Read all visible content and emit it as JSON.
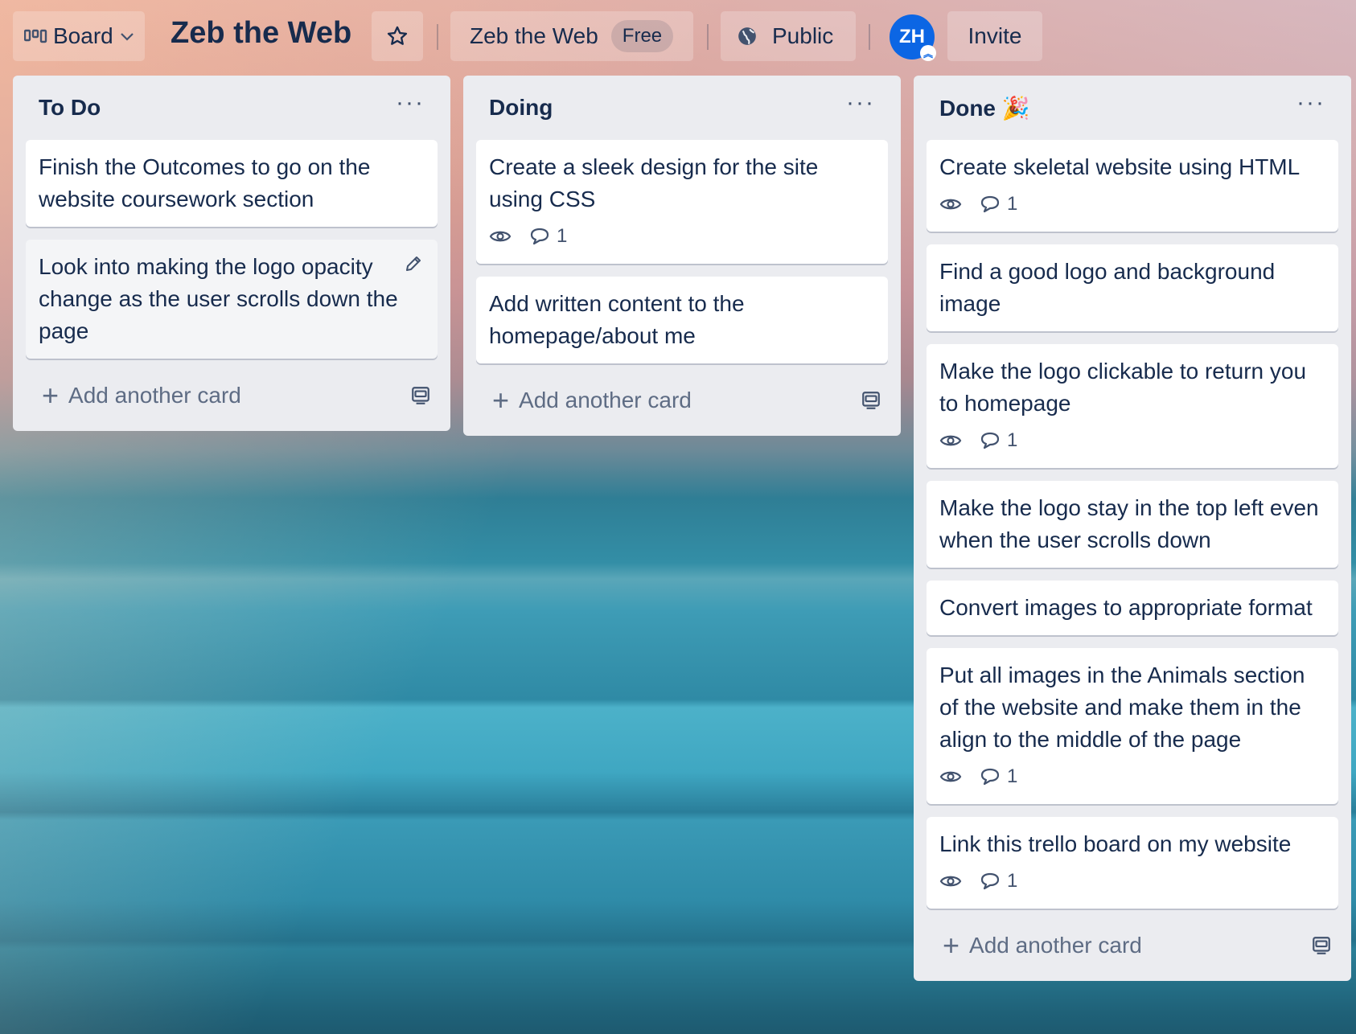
{
  "topbar": {
    "view_label": "Board",
    "board_title": "Zeb the Web",
    "workspace_name": "Zeb the Web",
    "workspace_plan": "Free",
    "visibility_label": "Public",
    "avatar_initials": "ZH",
    "invite_label": "Invite"
  },
  "lists": [
    {
      "title": "To Do",
      "title_emoji": "",
      "add_card_label": "Add another card",
      "cards": [
        {
          "text": "Finish the Outcomes to go on the website coursework section"
        },
        {
          "text": "Look into making the logo opacity change as the user scrolls down the page"
        }
      ]
    },
    {
      "title": "Doing",
      "title_emoji": "",
      "add_card_label": "Add another card",
      "cards": [
        {
          "text": "Create a sleek design for the site using CSS",
          "comments": "1"
        },
        {
          "text": "Add written content to the homepage/about me"
        }
      ]
    },
    {
      "title": "Done",
      "title_emoji": "🎉",
      "add_card_label": "Add another card",
      "cards": [
        {
          "text": "Create skeletal website using HTML",
          "comments": "1"
        },
        {
          "text": "Find a good logo and background image"
        },
        {
          "text": "Make the logo clickable to return you to homepage",
          "comments": "1"
        },
        {
          "text": "Make the logo stay in the top left even when the user scrolls down"
        },
        {
          "text": "Convert images to appropriate format"
        },
        {
          "text": "Put all images in the Animals section of the website and make them in the align to the middle of the page",
          "comments": "1"
        },
        {
          "text": "Link this trello board on my website",
          "comments": "1"
        }
      ]
    }
  ]
}
